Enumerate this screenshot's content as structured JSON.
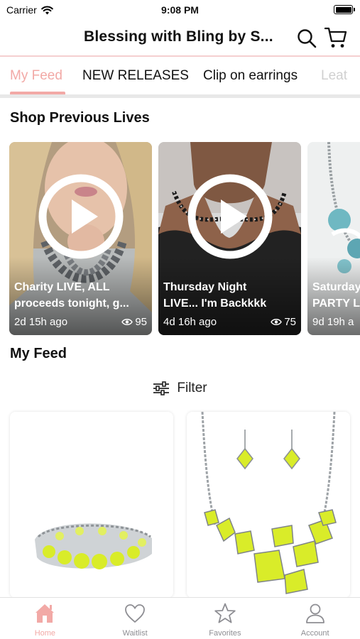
{
  "status_bar": {
    "carrier": "Carrier",
    "time": "9:08 PM"
  },
  "header": {
    "title": "Blessing with Bling by S..."
  },
  "tabs": [
    {
      "label": "My Feed"
    },
    {
      "label": "NEW RELEASES"
    },
    {
      "label": "Clip on earrings"
    },
    {
      "label": "Leat"
    }
  ],
  "sections": {
    "previous_lives": "Shop Previous Lives",
    "my_feed": "My Feed"
  },
  "lives": [
    {
      "line1": "Charity LIVE, ALL",
      "line2": "proceeds tonight, g...",
      "age": "2d 15h ago",
      "views": "95"
    },
    {
      "line1": "Thursday Night",
      "line2": "LIVE... I'm Backkkk",
      "age": "4d 16h ago",
      "views": "75"
    },
    {
      "line1": "Saturday",
      "line2": "PARTY L",
      "age": "9d 19h a",
      "views": ""
    }
  ],
  "filter": {
    "label": "Filter"
  },
  "tabbar": [
    {
      "label": "Home"
    },
    {
      "label": "Waitlist"
    },
    {
      "label": "Favorites"
    },
    {
      "label": "Account"
    }
  ],
  "colors": {
    "accent": "#f2a9a6",
    "divider": "#f5cfd0",
    "inactive": "#8e8e93",
    "product_yellow": "#d9ec29"
  },
  "icons": [
    "wifi-icon",
    "battery-icon",
    "search-icon",
    "cart-icon",
    "play-icon",
    "eye-icon",
    "filter-icon",
    "home-icon",
    "heart-icon",
    "star-icon",
    "person-icon"
  ]
}
